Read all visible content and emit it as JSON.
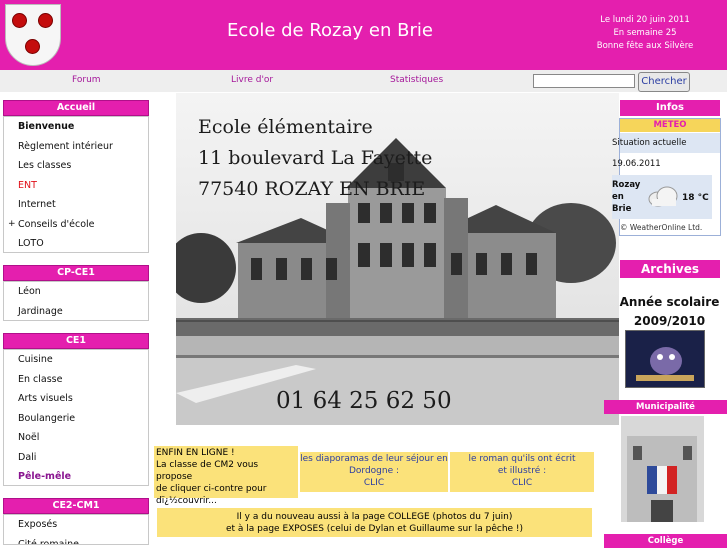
{
  "header": {
    "title": "Ecole de Rozay en Brie",
    "date_line1": "Le lundi 20 juin 2011",
    "date_line2": "En semaine 25",
    "date_line3": "Bonne fête aux Silvère"
  },
  "nav": {
    "forum": "Forum",
    "guestbook": "Livre d'or",
    "stats": "Statistiques",
    "search_button": "Chercher"
  },
  "sidebar": {
    "accueil": {
      "title": "Accueil",
      "items": [
        "Bienvenue",
        "Règlement intérieur",
        "Les classes",
        "ENT",
        "Internet",
        "Conseils d'école",
        "LOTO"
      ]
    },
    "cpce1": {
      "title": "CP-CE1",
      "items": [
        "Léon",
        "Jardinage"
      ]
    },
    "ce1": {
      "title": "CE1",
      "items": [
        "Cuisine",
        "En classe",
        "Arts visuels",
        "Boulangerie",
        "Noël",
        "Dali",
        "Pêle-mêle"
      ]
    },
    "ce2cm1": {
      "title": "CE2-CM1",
      "items": [
        "Exposés",
        "Cité romaine"
      ]
    }
  },
  "hero": {
    "line1": "Ecole élémentaire",
    "line2": "11 boulevard La Fayette",
    "line3": "77540 ROZAY EN BRIE",
    "phone": "01 64 25 62 50"
  },
  "notices": {
    "online_title": "ENFIN EN LIGNE !",
    "online_l1": "La classe de CM2 vous propose",
    "online_l2": "de cliquer ci-contre pour",
    "online_l3": "dï¿½couvrir...",
    "slides_l1": "les diaporamas de leur séjour en",
    "slides_l2": "Dordogne :",
    "slides_clic": "CLIC",
    "novel_l1": "le roman qu'ils ont écrit",
    "novel_l2": "et illustré :",
    "novel_clic": "CLIC",
    "bottom_l1": "Il y a du nouveau aussi à  la page COLLEGE (photos du 7 juin)",
    "bottom_l2": "et à la page EXPOSES (celui de Dylan et Guillaume sur la pêche !)"
  },
  "infos": {
    "title": "Infos",
    "meteo_label": "METEO",
    "situation": "Situation actuelle",
    "date": "19.06.2011",
    "city_l1": "Rozay",
    "city_l2": "en",
    "city_l3": "Brie",
    "temperature": "18 °C",
    "credit": "© WeatherOnline Ltd."
  },
  "archives": {
    "title": "Archives",
    "year_label": "Année scolaire",
    "year": "2009/2010"
  },
  "municipalite": {
    "title": "Municipalité"
  },
  "college": {
    "title": "Collège"
  },
  "colors": {
    "brand_pink": "#e41fae",
    "link_blue": "#2b3ea3",
    "notice_yellow": "#fbe27a",
    "ent_red": "#e0101a",
    "active_purple": "#8a1590"
  }
}
